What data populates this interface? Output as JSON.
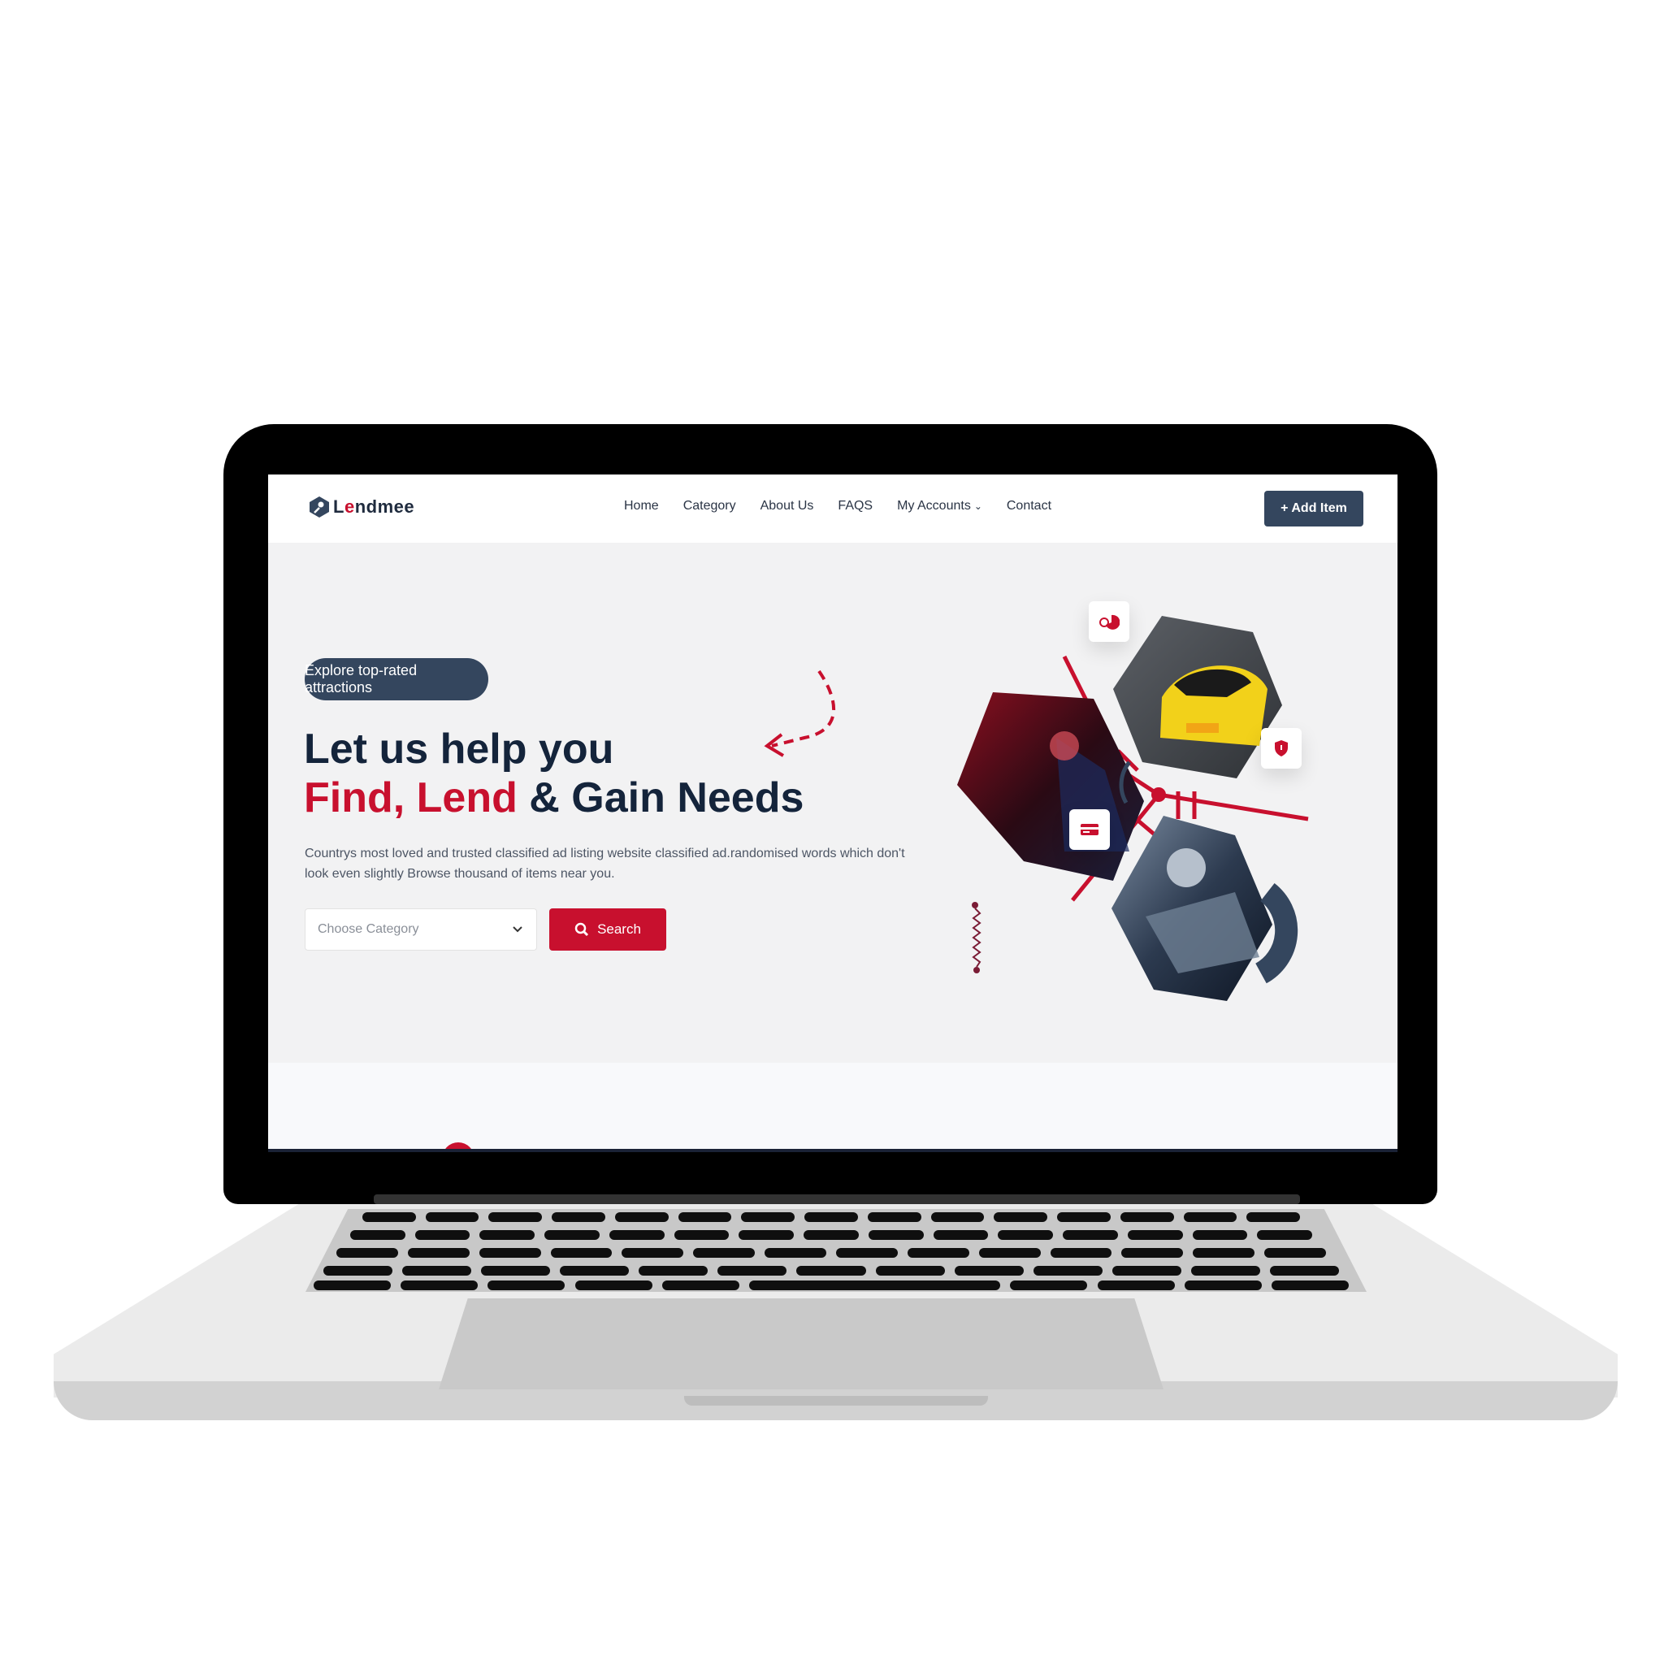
{
  "nav": {
    "logo_prefix": "L",
    "logo_accent": "e",
    "logo_suffix": "ndmee",
    "items": [
      {
        "label": "Home"
      },
      {
        "label": "Category"
      },
      {
        "label": "About Us"
      },
      {
        "label": "FAQS"
      },
      {
        "label": "My Accounts"
      },
      {
        "label": "Contact"
      }
    ],
    "add_button": "+ Add Item"
  },
  "hero": {
    "badge": "Explore top-rated attractions",
    "title_line1": "Let us help you",
    "title_red": "Find, Lend",
    "title_dark": " & Gain Needs",
    "description": "Countrys most loved and trusted classified ad listing website classified ad.randomised words which don't look even slightly Browse thousand of items near you.",
    "select_placeholder": "Choose Category",
    "search_label": "Search"
  },
  "icons": [
    "hexagon-logo-icon",
    "chevron-down-icon",
    "search-icon",
    "pie-chart-icon",
    "shield-icon",
    "card-icon"
  ],
  "colors": {
    "accent": "#c8102e",
    "navy": "#34465e",
    "title": "#14243b"
  }
}
